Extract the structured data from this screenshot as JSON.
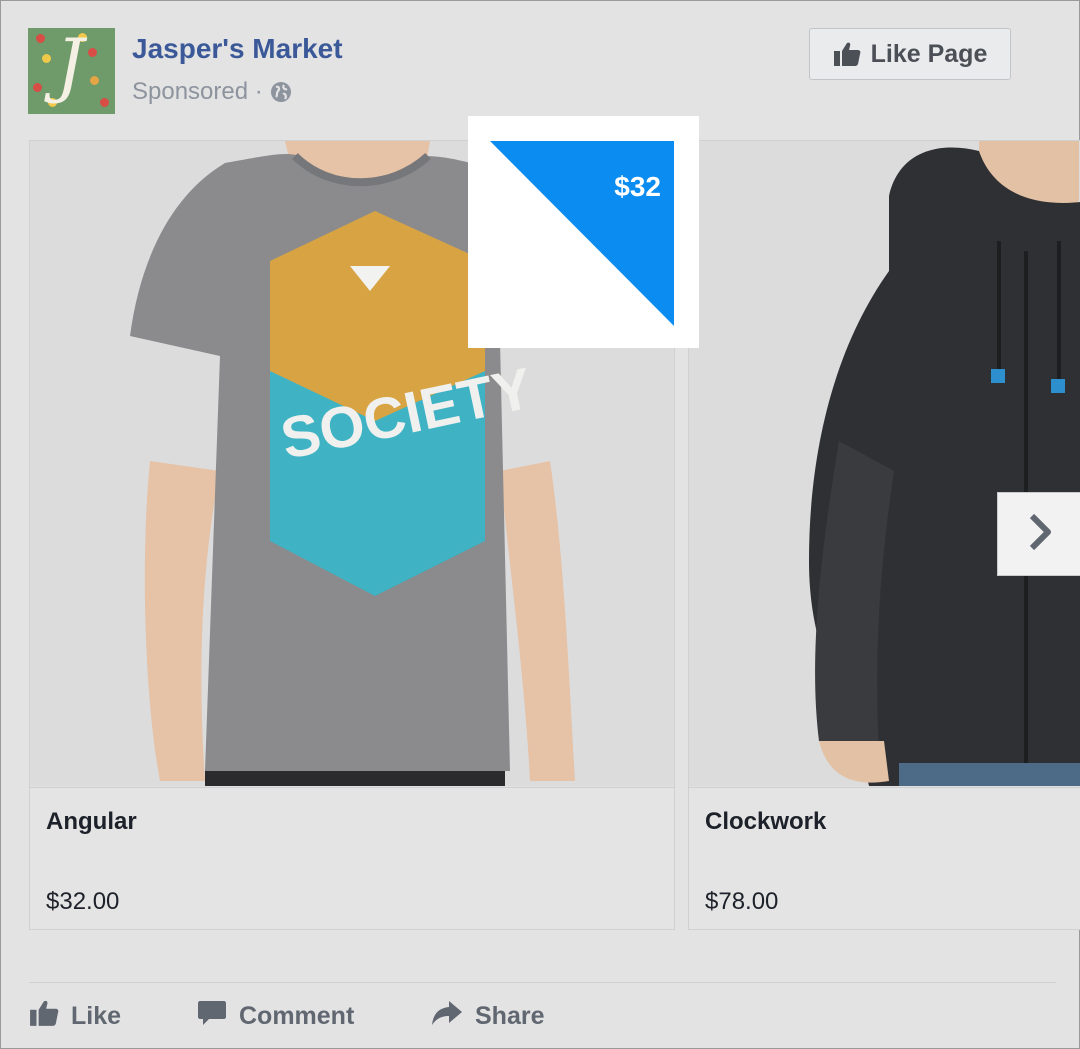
{
  "post": {
    "page_name": "Jasper's Market",
    "sponsored_label": "Sponsored ·",
    "avatar_letter": "J",
    "like_page_label": "Like Page"
  },
  "carousel": {
    "price_tag": "$32",
    "items": [
      {
        "name": "Angular",
        "price": "$32.00"
      },
      {
        "name": "Clockwork",
        "price": "$78.00"
      }
    ]
  },
  "actions": {
    "like": "Like",
    "comment": "Comment",
    "share": "Share"
  },
  "colors": {
    "brand_blue": "#3b5998",
    "price_tag_blue": "#0a8cf0",
    "icon_gray": "#606770"
  },
  "icons": [
    "globe-icon",
    "thumbs-up-icon",
    "chevron-right-icon",
    "comment-icon",
    "share-icon"
  ]
}
